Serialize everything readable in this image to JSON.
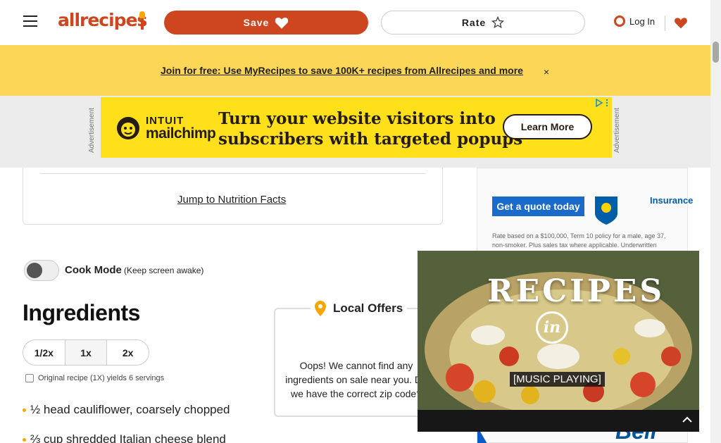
{
  "header": {
    "logo": "allrecipes",
    "save_label": "Save",
    "rate_label": "Rate",
    "login_label": "Log In"
  },
  "promo": {
    "text": "Join for free: Use MyRecipes to save 100K+ recipes from Allrecipes and more",
    "close_symbol": "×"
  },
  "ad": {
    "label": "Advertisement",
    "brand_top": "INTUIT",
    "brand_bottom": "mailchimp",
    "headline_line1": "Turn your website visitors into",
    "headline_line2": "subscribers with targeted popups",
    "cta": "Learn More"
  },
  "nutrition": {
    "link": "Jump to Nutrition Facts"
  },
  "cook_mode": {
    "label": "Cook Mode",
    "sub": "(Keep screen awake)",
    "enabled": false
  },
  "ingredients": {
    "title": "Ingredients",
    "scale_options": [
      "1/2x",
      "1x",
      "2x"
    ],
    "scale_selected": "1x",
    "yield_note": "Original recipe (1X) yields 6 servings",
    "items": [
      "½ head cauliflower, coarsely chopped",
      "⅔ cup shredded Italian cheese blend"
    ]
  },
  "local_offers": {
    "title": "Local Offers",
    "message": "Oops! We cannot find any ingredients on sale near you. Do we have the correct zip code?"
  },
  "rail_ad": {
    "quote_button": "Get a quote today",
    "insurer": "Insurance",
    "fine_print": "Rate based on a $100,000, Term 10 policy for a male, age 37, non-smoker. Plus sales tax where applicable. Underwritten",
    "bell": "Bell"
  },
  "video": {
    "title": "RECIPES",
    "badge": "in",
    "caption": "[MUSIC PLAYING]"
  },
  "colors": {
    "brand": "#ce4620",
    "promo_bg": "#fcd757",
    "ad_bg": "#ffe01b",
    "bullet": "#f7a600",
    "rbc_blue": "#1a6ac9"
  }
}
